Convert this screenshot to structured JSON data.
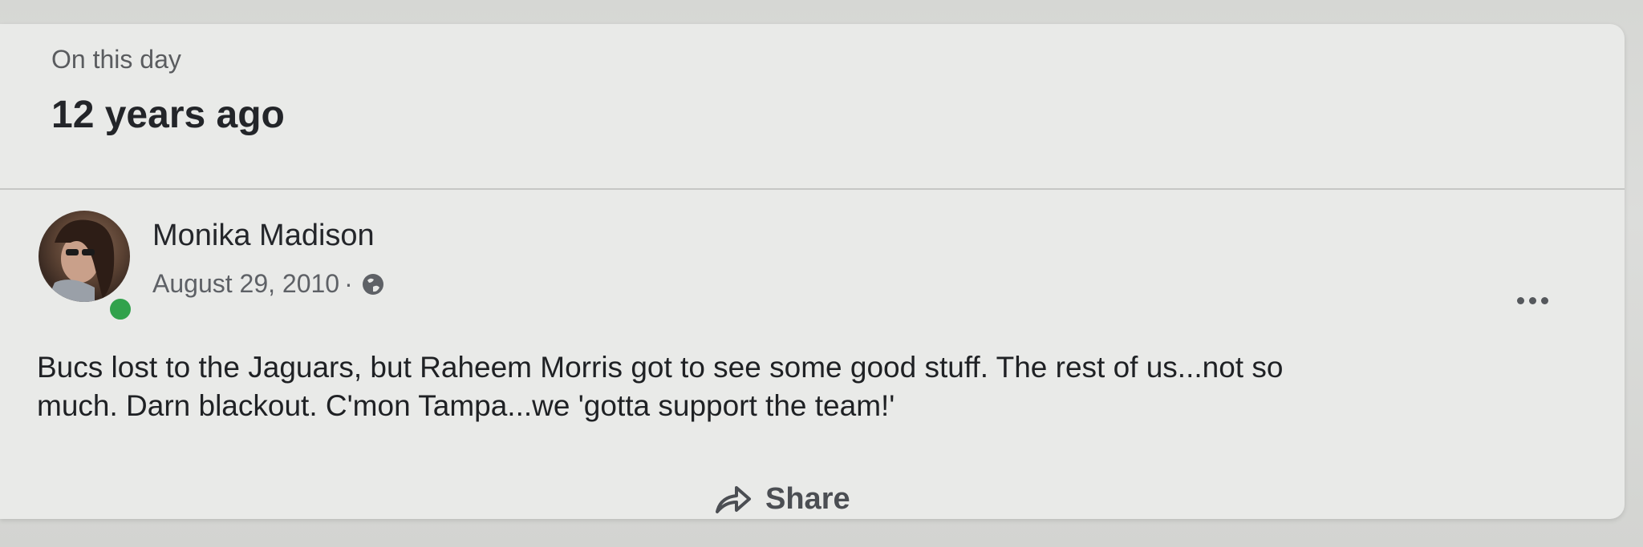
{
  "memory": {
    "caption": "On this day",
    "title": "12 years ago"
  },
  "post": {
    "author": "Monika Madison",
    "date": "August 29, 2010",
    "separator": "·",
    "audience_icon": "globe-icon",
    "online_status": "online",
    "text_lines": [
      "Bucs lost to the Jaguars, but Raheem Morris got to see some good stuff.  The rest of us...not so",
      "much. Darn blackout. C'mon Tampa...we 'gotta support the team!'"
    ],
    "more_icon": "more-options-icon"
  },
  "actions": {
    "share_label": "Share",
    "share_icon": "share-icon"
  },
  "colors": {
    "card_background": "#e9eae8",
    "online": "#31a24c",
    "text_primary": "#1f2124",
    "text_secondary": "#5e6166"
  }
}
